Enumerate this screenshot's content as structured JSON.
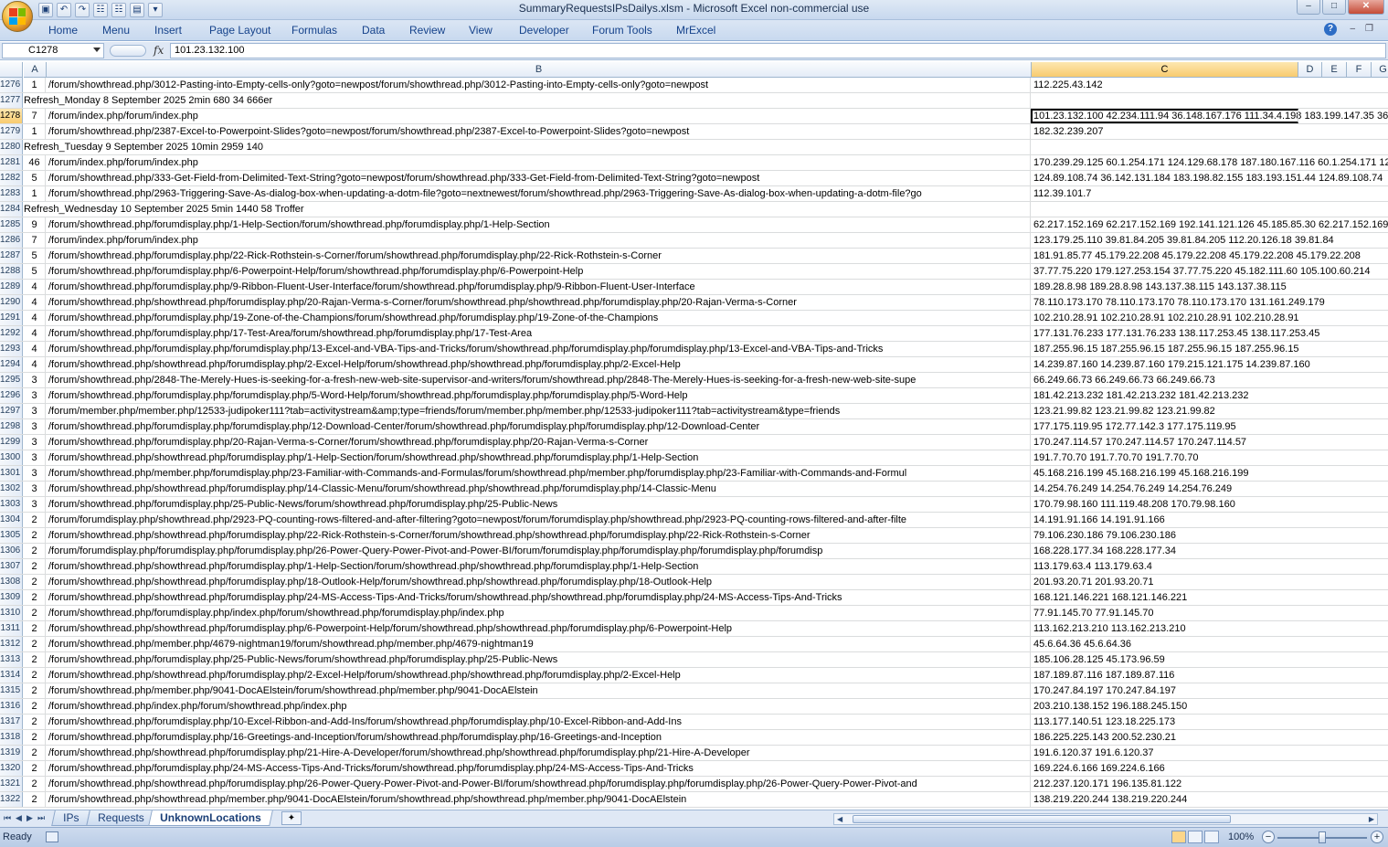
{
  "titlebar": {
    "title": "SummaryRequestsIPsDailys.xlsm  -  Microsoft Excel non-commercial use",
    "qat_icons": [
      "save-icon",
      "undo-icon",
      "redo-icon"
    ]
  },
  "ribbon": {
    "tabs": [
      "Home",
      "Menu",
      "Insert",
      "Page Layout",
      "Formulas",
      "Data",
      "Review",
      "View",
      "Developer",
      "Forum Tools",
      "MrExcel"
    ],
    "help_glyph": "?"
  },
  "formula_bar": {
    "name_box": "C1278",
    "fx_label": "fx",
    "formula": "101.23.132.100"
  },
  "columns": [
    "A",
    "B",
    "C",
    "D",
    "E",
    "F",
    "G"
  ],
  "active_column": "C",
  "active_row": "1278",
  "rows": [
    {
      "num": "1276",
      "a": "1",
      "b": "/forum/showthread.php/3012-Pasting-into-Empty-cells-only?goto=newpost/forum/showthread.php/3012-Pasting-into-Empty-cells-only?goto=newpost",
      "c": "112.225.43.142"
    },
    {
      "num": "1277",
      "note": "Refresh_Monday 8 September 2025   2min  680 34   666er"
    },
    {
      "num": "1278",
      "a": "7",
      "b": "/forum/index.php/forum/index.php",
      "c": "101.23.132.100 42.234.111.94 36.148.167.176 111.34.4.198 183.199.147.35 36."
    },
    {
      "num": "1279",
      "a": "1",
      "b": "/forum/showthread.php/2387-Excel-to-Powerpoint-Slides?goto=newpost/forum/showthread.php/2387-Excel-to-Powerpoint-Slides?goto=newpost",
      "c": "182.32.239.207"
    },
    {
      "num": "1280",
      "note": "Refresh_Tuesday 9 September 2025  10min  2959 140"
    },
    {
      "num": "1281",
      "a": "46",
      "b": "/forum/index.php/forum/index.php",
      "c": "170.239.29.125 60.1.254.171 124.129.68.178 187.180.167.116 60.1.254.171 124"
    },
    {
      "num": "1282",
      "a": "5",
      "b": "/forum/showthread.php/333-Get-Field-from-Delimited-Text-String?goto=newpost/forum/showthread.php/333-Get-Field-from-Delimited-Text-String?goto=newpost",
      "c": "124.89.108.74 36.142.131.184 183.198.82.155 183.193.151.44 124.89.108.74"
    },
    {
      "num": "1283",
      "a": "1",
      "b": "/forum/showthread.php/2963-Triggering-Save-As-dialog-box-when-updating-a-dotm-file?goto=nextnewest/forum/showthread.php/2963-Triggering-Save-As-dialog-box-when-updating-a-dotm-file?go",
      "c": "112.39.101.7"
    },
    {
      "num": "1284",
      "note": "Refresh_Wednesday 10 September 2025 5min  1440 58 Troffer"
    },
    {
      "num": "1285",
      "a": "9",
      "b": "/forum/showthread.php/forumdisplay.php/1-Help-Section/forum/showthread.php/forumdisplay.php/1-Help-Section",
      "c": "62.217.152.169 62.217.152.169 192.141.121.126 45.185.85.30 62.217.152.169 1"
    },
    {
      "num": "1286",
      "a": "7",
      "b": "/forum/index.php/forum/index.php",
      "c": "123.179.25.110 39.81.84.205 39.81.84.205 112.20.126.18 39.81.84"
    },
    {
      "num": "1287",
      "a": "5",
      "b": "/forum/showthread.php/forumdisplay.php/22-Rick-Rothstein-s-Corner/forum/showthread.php/forumdisplay.php/22-Rick-Rothstein-s-Corner",
      "c": "181.91.85.77 45.179.22.208 45.179.22.208 45.179.22.208 45.179.22.208"
    },
    {
      "num": "1288",
      "a": "5",
      "b": "/forum/showthread.php/forumdisplay.php/6-Powerpoint-Help/forum/showthread.php/forumdisplay.php/6-Powerpoint-Help",
      "c": "37.77.75.220 179.127.253.154 37.77.75.220 45.182.111.60 105.100.60.214"
    },
    {
      "num": "1289",
      "a": "4",
      "b": "/forum/showthread.php/forumdisplay.php/9-Ribbon-Fluent-User-Interface/forum/showthread.php/forumdisplay.php/9-Ribbon-Fluent-User-Interface",
      "c": "189.28.8.98 189.28.8.98 143.137.38.115 143.137.38.115"
    },
    {
      "num": "1290",
      "a": "4",
      "b": "/forum/showthread.php/showthread.php/forumdisplay.php/20-Rajan-Verma-s-Corner/forum/showthread.php/showthread.php/forumdisplay.php/20-Rajan-Verma-s-Corner",
      "c": "78.110.173.170 78.110.173.170 78.110.173.170 131.161.249.179"
    },
    {
      "num": "1291",
      "a": "4",
      "b": "/forum/showthread.php/forumdisplay.php/19-Zone-of-the-Champions/forum/showthread.php/forumdisplay.php/19-Zone-of-the-Champions",
      "c": "102.210.28.91 102.210.28.91 102.210.28.91 102.210.28.91"
    },
    {
      "num": "1292",
      "a": "4",
      "b": "/forum/showthread.php/forumdisplay.php/17-Test-Area/forum/showthread.php/forumdisplay.php/17-Test-Area",
      "c": "177.131.76.233 177.131.76.233 138.117.253.45 138.117.253.45"
    },
    {
      "num": "1293",
      "a": "4",
      "b": "/forum/showthread.php/forumdisplay.php/forumdisplay.php/13-Excel-and-VBA-Tips-and-Tricks/forum/showthread.php/forumdisplay.php/forumdisplay.php/13-Excel-and-VBA-Tips-and-Tricks",
      "c": "187.255.96.15 187.255.96.15 187.255.96.15 187.255.96.15"
    },
    {
      "num": "1294",
      "a": "4",
      "b": "/forum/showthread.php/showthread.php/forumdisplay.php/2-Excel-Help/forum/showthread.php/showthread.php/forumdisplay.php/2-Excel-Help",
      "c": "14.239.87.160 14.239.87.160 179.215.121.175 14.239.87.160"
    },
    {
      "num": "1295",
      "a": "3",
      "b": "/forum/showthread.php/2848-The-Merely-Hues-is-seeking-for-a-fresh-new-web-site-supervisor-and-writers/forum/showthread.php/2848-The-Merely-Hues-is-seeking-for-a-fresh-new-web-site-supe",
      "c": "66.249.66.73 66.249.66.73 66.249.66.73"
    },
    {
      "num": "1296",
      "a": "3",
      "b": "/forum/showthread.php/forumdisplay.php/forumdisplay.php/5-Word-Help/forum/showthread.php/forumdisplay.php/forumdisplay.php/5-Word-Help",
      "c": "181.42.213.232 181.42.213.232 181.42.213.232"
    },
    {
      "num": "1297",
      "a": "3",
      "b": "/forum/member.php/member.php/12533-judipoker111?tab=activitystream&amp;type=friends/forum/member.php/member.php/12533-judipoker111?tab=activitystream&type=friends",
      "c": "123.21.99.82 123.21.99.82 123.21.99.82"
    },
    {
      "num": "1298",
      "a": "3",
      "b": "/forum/showthread.php/forumdisplay.php/forumdisplay.php/12-Download-Center/forum/showthread.php/forumdisplay.php/forumdisplay.php/12-Download-Center",
      "c": "177.175.119.95 172.77.142.3 177.175.119.95"
    },
    {
      "num": "1299",
      "a": "3",
      "b": "/forum/showthread.php/forumdisplay.php/20-Rajan-Verma-s-Corner/forum/showthread.php/forumdisplay.php/20-Rajan-Verma-s-Corner",
      "c": "170.247.114.57 170.247.114.57 170.247.114.57"
    },
    {
      "num": "1300",
      "a": "3",
      "b": "/forum/showthread.php/showthread.php/forumdisplay.php/1-Help-Section/forum/showthread.php/showthread.php/forumdisplay.php/1-Help-Section",
      "c": "191.7.70.70 191.7.70.70 191.7.70.70"
    },
    {
      "num": "1301",
      "a": "3",
      "b": "/forum/showthread.php/member.php/forumdisplay.php/23-Familiar-with-Commands-and-Formulas/forum/showthread.php/member.php/forumdisplay.php/23-Familiar-with-Commands-and-Formul",
      "c": "45.168.216.199 45.168.216.199 45.168.216.199"
    },
    {
      "num": "1302",
      "a": "3",
      "b": "/forum/showthread.php/showthread.php/forumdisplay.php/14-Classic-Menu/forum/showthread.php/showthread.php/forumdisplay.php/14-Classic-Menu",
      "c": "14.254.76.249 14.254.76.249 14.254.76.249"
    },
    {
      "num": "1303",
      "a": "3",
      "b": "/forum/showthread.php/forumdisplay.php/25-Public-News/forum/showthread.php/forumdisplay.php/25-Public-News",
      "c": "170.79.98.160 111.119.48.208 170.79.98.160"
    },
    {
      "num": "1304",
      "a": "2",
      "b": "/forum/forumdisplay.php/showthread.php/2923-PQ-counting-rows-filtered-and-after-filtering?goto=newpost/forum/forumdisplay.php/showthread.php/2923-PQ-counting-rows-filtered-and-after-filte",
      "c": "14.191.91.166 14.191.91.166"
    },
    {
      "num": "1305",
      "a": "2",
      "b": "/forum/showthread.php/showthread.php/forumdisplay.php/22-Rick-Rothstein-s-Corner/forum/showthread.php/showthread.php/forumdisplay.php/22-Rick-Rothstein-s-Corner",
      "c": "79.106.230.186 79.106.230.186"
    },
    {
      "num": "1306",
      "a": "2",
      "b": "/forum/forumdisplay.php/forumdisplay.php/forumdisplay.php/26-Power-Query-Power-Pivot-and-Power-BI/forum/forumdisplay.php/forumdisplay.php/forumdisplay.php/forumdisp",
      "c": "168.228.177.34 168.228.177.34"
    },
    {
      "num": "1307",
      "a": "2",
      "b": "/forum/showthread.php/showthread.php/forumdisplay.php/1-Help-Section/forum/showthread.php/showthread.php/forumdisplay.php/1-Help-Section",
      "c": "113.179.63.4 113.179.63.4"
    },
    {
      "num": "1308",
      "a": "2",
      "b": "/forum/showthread.php/showthread.php/forumdisplay.php/18-Outlook-Help/forum/showthread.php/showthread.php/forumdisplay.php/18-Outlook-Help",
      "c": "201.93.20.71 201.93.20.71"
    },
    {
      "num": "1309",
      "a": "2",
      "b": "/forum/showthread.php/showthread.php/forumdisplay.php/24-MS-Access-Tips-And-Tricks/forum/showthread.php/showthread.php/forumdisplay.php/24-MS-Access-Tips-And-Tricks",
      "c": "168.121.146.221 168.121.146.221"
    },
    {
      "num": "1310",
      "a": "2",
      "b": "/forum/showthread.php/forumdisplay.php/index.php/forum/showthread.php/forumdisplay.php/index.php",
      "c": "77.91.145.70 77.91.145.70"
    },
    {
      "num": "1311",
      "a": "2",
      "b": "/forum/showthread.php/showthread.php/forumdisplay.php/6-Powerpoint-Help/forum/showthread.php/showthread.php/forumdisplay.php/6-Powerpoint-Help",
      "c": "113.162.213.210 113.162.213.210"
    },
    {
      "num": "1312",
      "a": "2",
      "b": "/forum/showthread.php/member.php/4679-nightman19/forum/showthread.php/member.php/4679-nightman19",
      "c": "45.6.64.36 45.6.64.36"
    },
    {
      "num": "1313",
      "a": "2",
      "b": "/forum/showthread.php/forumdisplay.php/25-Public-News/forum/showthread.php/forumdisplay.php/25-Public-News",
      "c": "185.106.28.125 45.173.96.59"
    },
    {
      "num": "1314",
      "a": "2",
      "b": "/forum/showthread.php/showthread.php/forumdisplay.php/2-Excel-Help/forum/showthread.php/showthread.php/forumdisplay.php/2-Excel-Help",
      "c": "187.189.87.116 187.189.87.116"
    },
    {
      "num": "1315",
      "a": "2",
      "b": "/forum/showthread.php/member.php/9041-DocAElstein/forum/showthread.php/member.php/9041-DocAElstein",
      "c": "170.247.84.197 170.247.84.197"
    },
    {
      "num": "1316",
      "a": "2",
      "b": "/forum/showthread.php/index.php/forum/showthread.php/index.php",
      "c": "203.210.138.152 196.188.245.150"
    },
    {
      "num": "1317",
      "a": "2",
      "b": "/forum/showthread.php/forumdisplay.php/10-Excel-Ribbon-and-Add-Ins/forum/showthread.php/forumdisplay.php/10-Excel-Ribbon-and-Add-Ins",
      "c": "113.177.140.51 123.18.225.173"
    },
    {
      "num": "1318",
      "a": "2",
      "b": "/forum/showthread.php/forumdisplay.php/16-Greetings-and-Inception/forum/showthread.php/forumdisplay.php/16-Greetings-and-Inception",
      "c": "186.225.225.143 200.52.230.21"
    },
    {
      "num": "1319",
      "a": "2",
      "b": "/forum/showthread.php/showthread.php/forumdisplay.php/21-Hire-A-Developer/forum/showthread.php/showthread.php/forumdisplay.php/21-Hire-A-Developer",
      "c": "191.6.120.37 191.6.120.37"
    },
    {
      "num": "1320",
      "a": "2",
      "b": "/forum/showthread.php/forumdisplay.php/24-MS-Access-Tips-And-Tricks/forum/showthread.php/forumdisplay.php/24-MS-Access-Tips-And-Tricks",
      "c": "169.224.6.166 169.224.6.166"
    },
    {
      "num": "1321",
      "a": "2",
      "b": "/forum/showthread.php/showthread.php/forumdisplay.php/26-Power-Query-Power-Pivot-and-Power-BI/forum/showthread.php/forumdisplay.php/forumdisplay.php/26-Power-Query-Power-Pivot-and",
      "c": "212.237.120.171 196.135.81.122"
    },
    {
      "num": "1322",
      "a": "2",
      "b": "/forum/showthread.php/showthread.php/member.php/9041-DocAElstein/forum/showthread.php/showthread.php/member.php/9041-DocAElstein",
      "c": "138.219.220.244 138.219.220.244"
    }
  ],
  "sheet_tabs": {
    "tabs": [
      "IPs",
      "Requests",
      "UnknownLocations"
    ],
    "active": "UnknownLocations"
  },
  "statusbar": {
    "status": "Ready",
    "zoom": "100%",
    "zoom_level_percent": 100
  }
}
